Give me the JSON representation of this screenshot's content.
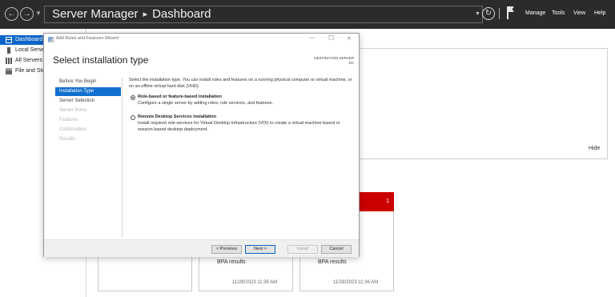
{
  "header": {
    "title": "Server Manager",
    "separator": "▸",
    "breadcrumb": "Dashboard",
    "menu": [
      "Manage",
      "Tools",
      "View",
      "Help"
    ]
  },
  "leftnav": {
    "items": [
      {
        "label": "Dashboard",
        "icon": "dashboard-icon",
        "selected": true
      },
      {
        "label": "Local Serve",
        "icon": "local-server-icon"
      },
      {
        "label": "All Servers",
        "icon": "all-servers-icon"
      },
      {
        "label": "File and Sto",
        "icon": "file-storage-icon"
      }
    ]
  },
  "dashboard": {
    "hide_label": "Hide",
    "tile_badge": "1",
    "tiles": [
      {
        "bpa": "BPA results",
        "timestamp": "11/28/2023 11:36 AM"
      },
      {
        "bpa": "BPA results",
        "timestamp": "11/28/2023 11:36 AM"
      }
    ]
  },
  "wizard": {
    "window_title": "Add Roles and Features Wizard",
    "heading": "Select installation type",
    "destination_label": "DESTINATION SERVER",
    "destination_value": "DC",
    "steps": [
      {
        "label": "Before You Begin",
        "state": "normal"
      },
      {
        "label": "Installation Type",
        "state": "active"
      },
      {
        "label": "Server Selection",
        "state": "normal"
      },
      {
        "label": "Server Roles",
        "state": "disabled"
      },
      {
        "label": "Features",
        "state": "disabled"
      },
      {
        "label": "Confirmation",
        "state": "disabled"
      },
      {
        "label": "Results",
        "state": "disabled"
      }
    ],
    "intro": "Select the installation type. You can install roles and features on a running physical computer or virtual machine, or on an offline virtual hard disk (VHD).",
    "options": [
      {
        "title": "Role-based or feature-based installation",
        "desc": "Configure a single server by adding roles, role services, and features.",
        "checked": true
      },
      {
        "title": "Remote Desktop Services installation",
        "desc": "Install required role services for Virtual Desktop Infrastructure (VDI) to create a virtual machine-based or session-based desktop deployment.",
        "checked": false
      }
    ],
    "buttons": {
      "previous": "< Previous",
      "next": "Next >",
      "install": "Install",
      "cancel": "Cancel"
    }
  },
  "colors": {
    "header_bg": "#2b2b2b",
    "selection": "#0a64c8",
    "alert_tile": "#cc0000"
  }
}
